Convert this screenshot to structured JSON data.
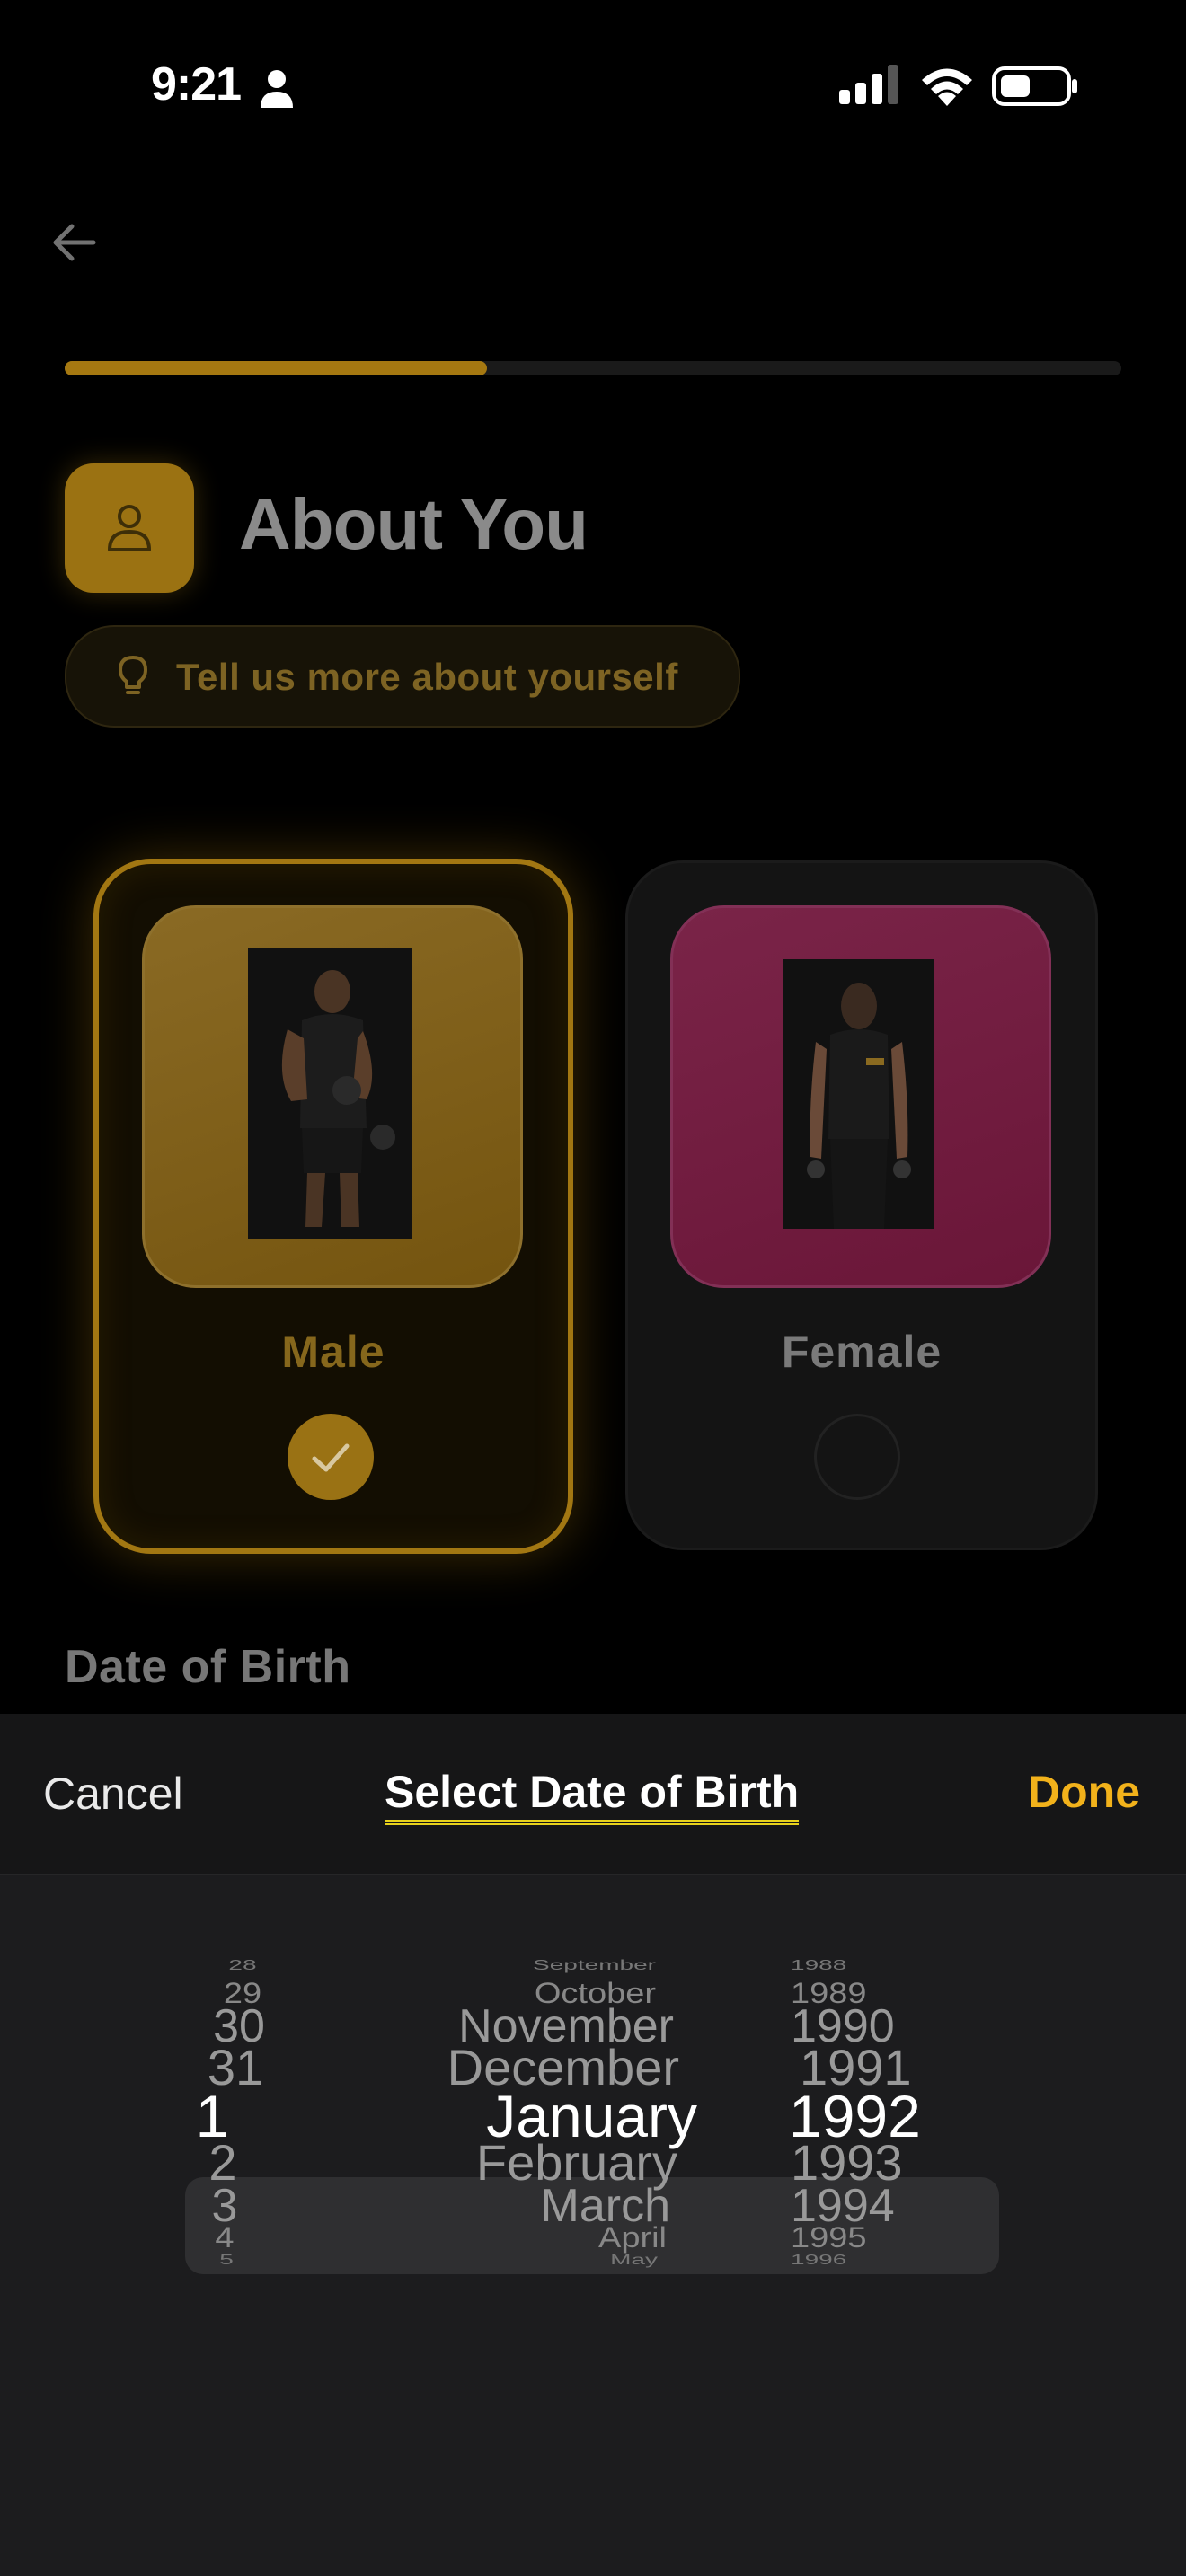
{
  "status_bar": {
    "time": "9:21"
  },
  "header": {
    "progress": 0.4,
    "title": "About You",
    "subtitle": "Tell us more about yourself",
    "accent": "#f2b21b"
  },
  "gender": {
    "options": [
      {
        "label": "Male",
        "selected": true
      },
      {
        "label": "Female",
        "selected": false
      }
    ]
  },
  "dob_label": "Date of Birth",
  "sheet": {
    "cancel": "Cancel",
    "title": "Select Date of Birth",
    "done": "Done"
  },
  "picker": {
    "days": [
      "28",
      "29",
      "30",
      "31",
      "1",
      "2",
      "3",
      "4",
      "5"
    ],
    "months": [
      "September",
      "October",
      "November",
      "December",
      "January",
      "February",
      "March",
      "April",
      "May"
    ],
    "years": [
      "1988",
      "1989",
      "1990",
      "1991",
      "1992",
      "1993",
      "1994",
      "1995",
      "1996"
    ],
    "selected_index": 4
  },
  "icons": {
    "back": "arrow-left-icon",
    "title": "person-icon",
    "subtitle": "lightbulb-icon",
    "check": "check-icon"
  }
}
